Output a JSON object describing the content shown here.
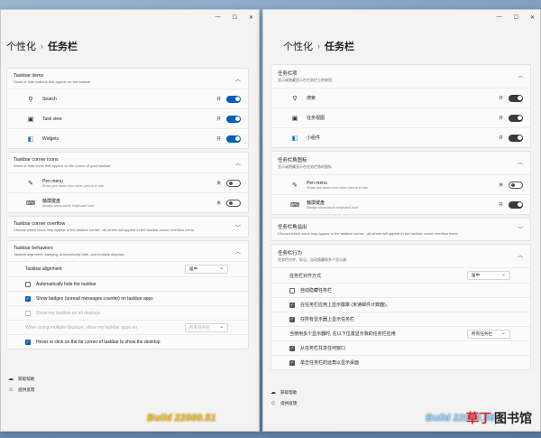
{
  "left": {
    "crumb_parent": "个性化",
    "crumb_current": "任务栏",
    "window_controls": [
      "—",
      "☐",
      "✕"
    ],
    "taskbar_items": {
      "title": "Taskbar items",
      "subtitle": "Show or hide buttons that appear on the taskbar",
      "rows": [
        {
          "label": "Search",
          "state": "开",
          "icon": "search-icon"
        },
        {
          "label": "Task view",
          "state": "开",
          "icon": "task-view-icon"
        },
        {
          "label": "Widgets",
          "state": "开",
          "icon": "widgets-icon"
        }
      ]
    },
    "corner_icons": {
      "title": "Taskbar corner icons",
      "subtitle": "Show or hide icons that appear on the corner of your taskbar",
      "rows": [
        {
          "label": "Pen menu",
          "sub": "Show pen menu icon when pen is in use",
          "state": "关"
        },
        {
          "label": "触摸键盘",
          "sub": "Always show touch keyboard icon",
          "state": "关"
        }
      ]
    },
    "overflow": {
      "title": "Taskbar corner overflow",
      "subtitle": "Choose which icons may appear in the taskbar corner - all others will appear in the taskbar corner overflow menu"
    },
    "behaviors": {
      "title": "Taskbar behaviors",
      "subtitle": "Taskbar alignment, badging, automatically hide, and multiple displays",
      "alignment_label": "Taskbar alignment",
      "alignment_value": "居中",
      "auto_hide": "Automatically hide the taskbar",
      "badges": "Show badges (unread messages counter) on taskbar apps",
      "all_displays": "Show my taskbar on all displays",
      "multi_display": "When using multiple displays, show my taskbar apps on",
      "multi_display_value": "所有任务栏",
      "far_corner": "Hover or click on the far corner of taskbar to show the desktop"
    },
    "help": "获取帮助",
    "feedback": "提供反馈",
    "build": "Build 22000.51"
  },
  "right": {
    "crumb_parent": "个性化",
    "crumb_current": "任务栏",
    "window_controls": [
      "—",
      "☐",
      "✕"
    ],
    "taskbar_items": {
      "title": "任务栏项",
      "subtitle": "显示或隐藏显示在任务栏上的按钮",
      "rows": [
        {
          "label": "搜索",
          "state": "开",
          "icon": "search-icon"
        },
        {
          "label": "任务视图",
          "state": "开",
          "icon": "task-view-icon"
        },
        {
          "label": "小组件",
          "state": "开",
          "icon": "widgets-icon"
        }
      ]
    },
    "corner_icons": {
      "title": "任务栏角图标",
      "subtitle": "显示或隐藏显示在任务栏角的图标",
      "rows": [
        {
          "label": "Pen menu",
          "sub": "Show pen menu icon when pen is in use",
          "state": "关"
        },
        {
          "label": "触摸键盘",
          "sub": "Always show touch keyboard icon",
          "state": "开"
        }
      ]
    },
    "overflow": {
      "title": "任务栏角溢出",
      "subtitle": "Choose which icons may appear in the taskbar corner - all others will appear in the taskbar corner overflow menu"
    },
    "behaviors": {
      "title": "任务栏行为",
      "subtitle": "任务栏对齐、标记、自动隐藏和多个显示器",
      "alignment_label": "任务栏对齐方式",
      "alignment_value": "居中",
      "auto_hide": "自动隐藏任务栏",
      "badges": "在任务栏应用上显示徽章 (未读邮件计数器)。",
      "all_displays": "在所有显示器上显示任务栏",
      "multi_display": "当使用多个显示器时, 在以下位置显示我的任务栏应用",
      "multi_display_value": "所有任务栏",
      "share": "从任务栏共享任何窗口",
      "far_corner": "单击任务栏的远角以显示桌面"
    },
    "help": "获取帮助",
    "feedback": "提供反馈",
    "build": "Build 22000.56"
  },
  "watermark": {
    "red": "草丁",
    "black": "图书馆"
  }
}
